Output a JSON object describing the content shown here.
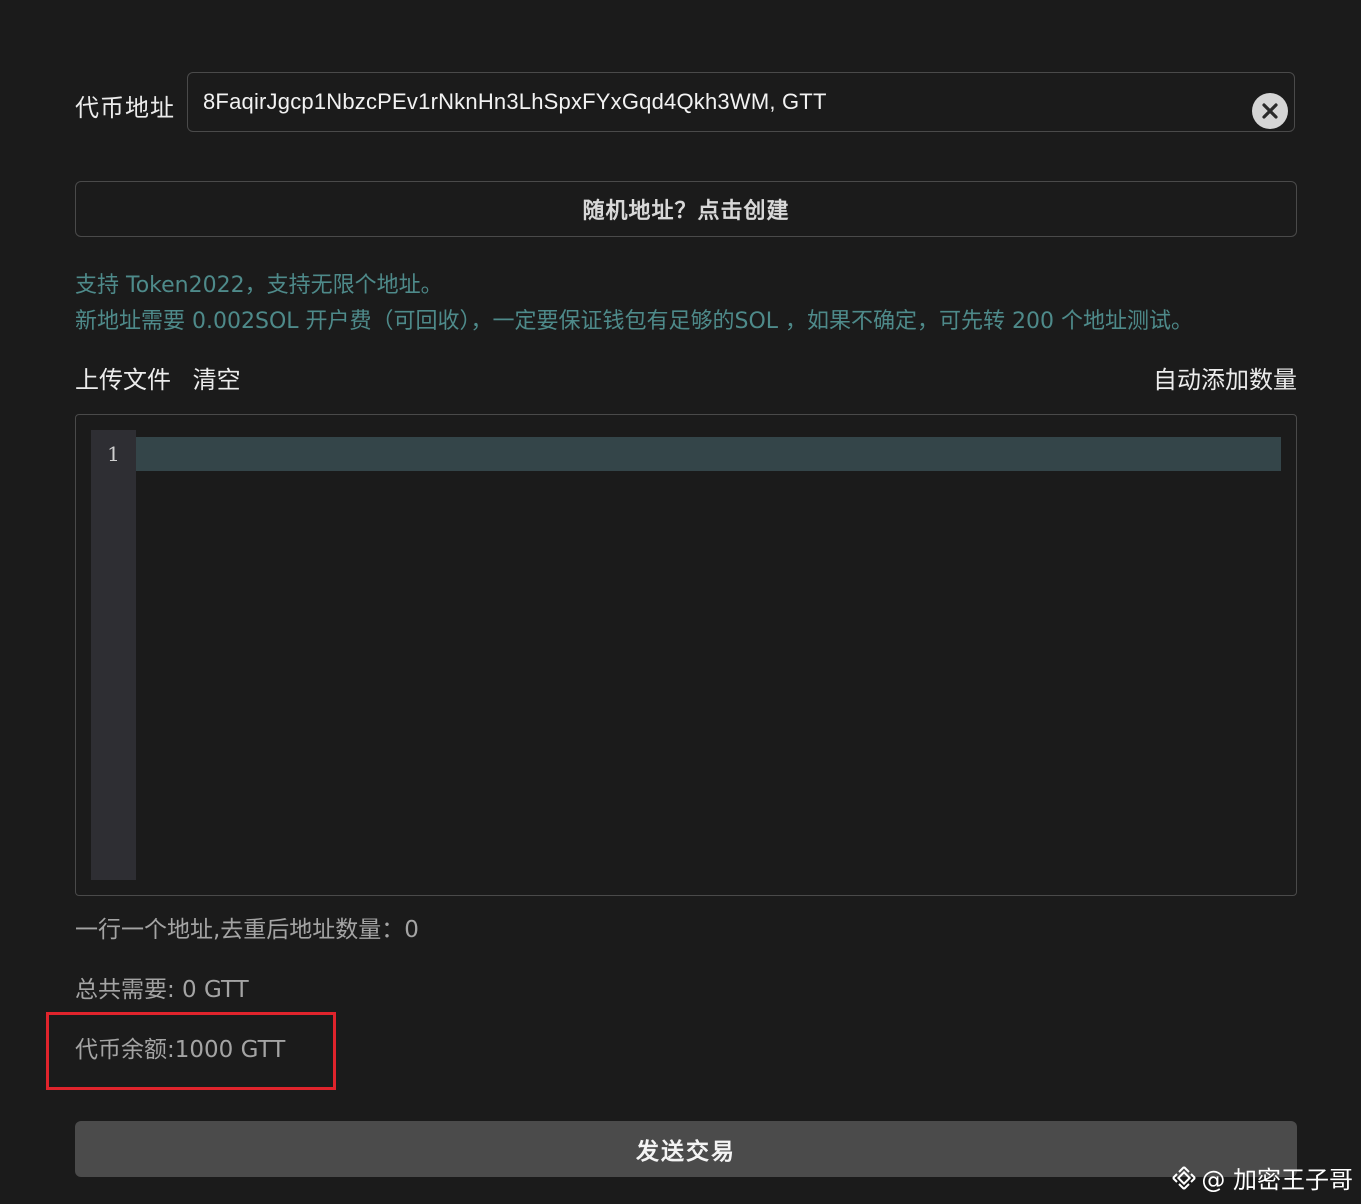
{
  "token_address": {
    "label": "代币地址",
    "value": "8FaqirJgcp1NbzcPEv1rNknHn3LhSpxFYxGqd4Qkh3WM, GTT",
    "clear_icon": "close-circle-icon"
  },
  "random_address_button": "随机地址？点击创建",
  "notes": {
    "line1": "支持 Token2022，支持无限个地址。",
    "line2": "新地址需要 0.002SOL 开户费（可回收），一定要保证钱包有足够的SOL ，如果不确定，可先转 200 个地址测试。"
  },
  "toolbar": {
    "upload": "上传文件",
    "clear": "清空",
    "auto_add": "自动添加数量"
  },
  "editor": {
    "line_numbers": [
      "1"
    ]
  },
  "stats": {
    "dedup_count": "一行一个地址,去重后地址数量：0",
    "total_needed": "总共需要: 0 GTT",
    "token_balance": "代币余额:1000 GTT"
  },
  "send_button": "发送交易",
  "watermark": {
    "text": "@ 加密王子哥",
    "icon": "binance-logo-icon"
  },
  "colors": {
    "background": "#1b1b1b",
    "note_text": "#4e8a8a",
    "highlight_border": "#e0242c",
    "send_button_bg": "#4b4b4b",
    "active_line": "#344549"
  }
}
